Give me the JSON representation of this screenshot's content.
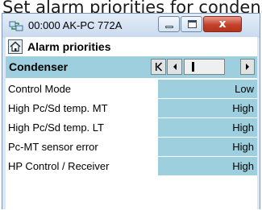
{
  "page": {
    "heading": "Set alarm priorities for condenser"
  },
  "window": {
    "title": "00:000 AK-PC 772A",
    "close_glyph": "x",
    "icon": "app-network-icon"
  },
  "header": {
    "title": "Alarm priorities",
    "icon": "home-icon"
  },
  "nav": {
    "title": "Condenser",
    "buttons": [
      "first-page-icon",
      "previous-page-icon",
      "page-indicator",
      "next-page-icon"
    ]
  },
  "rows": [
    {
      "label": "Control Mode",
      "value": "Low"
    },
    {
      "label": "High Pc/Sd temp. MT",
      "value": "High"
    },
    {
      "label": "High Pc/Sd temp. LT",
      "value": "High"
    },
    {
      "label": "Pc-MT sensor error",
      "value": "High"
    },
    {
      "label": "HP Control / Receiver",
      "value": "High"
    }
  ],
  "colors": {
    "accent": "#9ecfdf",
    "window_frame": "#dbe7f3",
    "close_button": "#c3422c"
  }
}
